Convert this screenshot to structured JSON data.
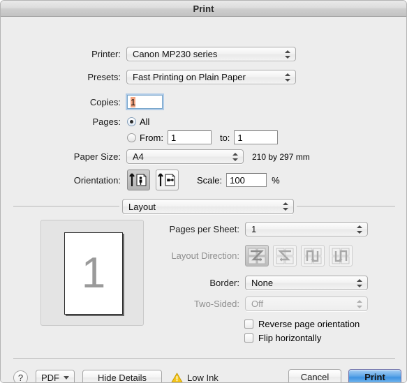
{
  "window": {
    "title": "Print"
  },
  "main": {
    "printer_label": "Printer:",
    "printer_value": "Canon MP230 series",
    "presets_label": "Presets:",
    "presets_value": "Fast Printing on Plain Paper",
    "copies_label": "Copies:",
    "copies_value": "1",
    "pages_label": "Pages:",
    "pages_all_label": "All",
    "pages_from_label": "From:",
    "pages_from_value": "1",
    "pages_to_label": "to:",
    "pages_to_value": "1",
    "paper_size_label": "Paper Size:",
    "paper_size_value": "A4",
    "paper_dimensions": "210 by 297 mm",
    "orientation_label": "Orientation:",
    "orientation_portrait_name": "portrait",
    "orientation_landscape_name": "landscape",
    "scale_label": "Scale:",
    "scale_value": "100",
    "scale_unit": "%"
  },
  "pane": {
    "selected": "Layout",
    "pages_per_sheet_label": "Pages per Sheet:",
    "pages_per_sheet_value": "1",
    "layout_direction_label": "Layout Direction:",
    "border_label": "Border:",
    "border_value": "None",
    "two_sided_label": "Two-Sided:",
    "two_sided_value": "Off",
    "reverse_page_orientation_label": "Reverse page orientation",
    "flip_horizontally_label": "Flip horizontally"
  },
  "preview": {
    "page_number": "1"
  },
  "footer": {
    "help_label": "?",
    "pdf_label": "PDF",
    "hide_details_label": "Hide Details",
    "status_label": "Low Ink",
    "cancel_label": "Cancel",
    "print_label": "Print"
  },
  "colors": {
    "accent": "#3f93e2",
    "warning": "#f5c518",
    "selection": "#f4a582",
    "window_bg": "#ededed"
  }
}
